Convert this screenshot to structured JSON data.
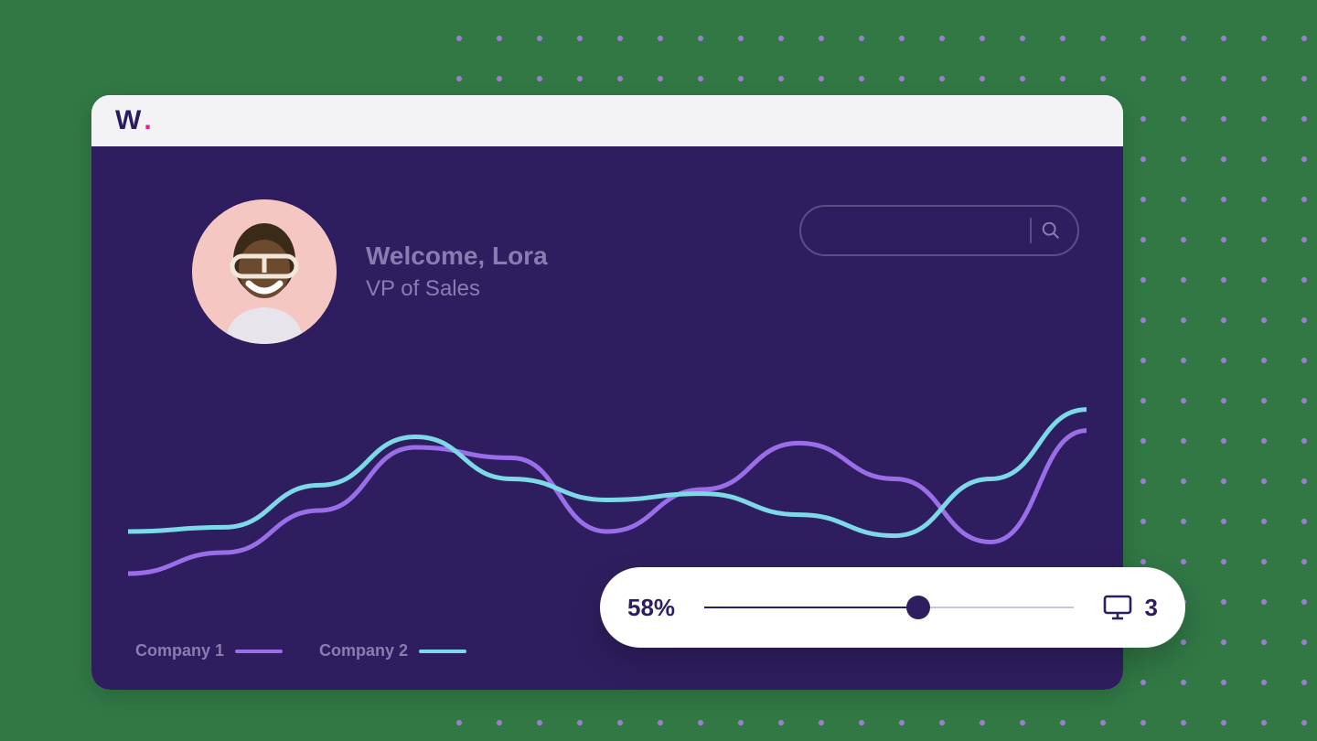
{
  "logo": {
    "mark": "W",
    "dot": "."
  },
  "user": {
    "welcome": "Welcome, Lora",
    "role": "VP of Sales"
  },
  "search": {
    "placeholder": ""
  },
  "legend": {
    "series_a": "Company 1",
    "series_b": "Company 2"
  },
  "slider": {
    "percent_label": "58%",
    "percent_value": 58,
    "count": "3"
  },
  "colors": {
    "bg": "#317845",
    "panel": "#2f1e5f",
    "accent_purple": "#9a6ee8",
    "accent_cyan": "#7dd8e8",
    "pink": "#e91e94"
  },
  "chart_data": {
    "type": "line",
    "x": [
      0,
      10,
      20,
      30,
      40,
      50,
      60,
      70,
      80,
      90,
      100
    ],
    "series": [
      {
        "name": "Company 1",
        "color": "#9a6ee8",
        "values": [
          10,
          20,
          40,
          70,
          65,
          30,
          50,
          72,
          55,
          25,
          78
        ]
      },
      {
        "name": "Company 2",
        "color": "#7dd8e8",
        "values": [
          30,
          32,
          52,
          75,
          55,
          45,
          48,
          38,
          28,
          55,
          88
        ]
      }
    ],
    "ylim": [
      0,
      100
    ],
    "title": "",
    "xlabel": "",
    "ylabel": ""
  }
}
